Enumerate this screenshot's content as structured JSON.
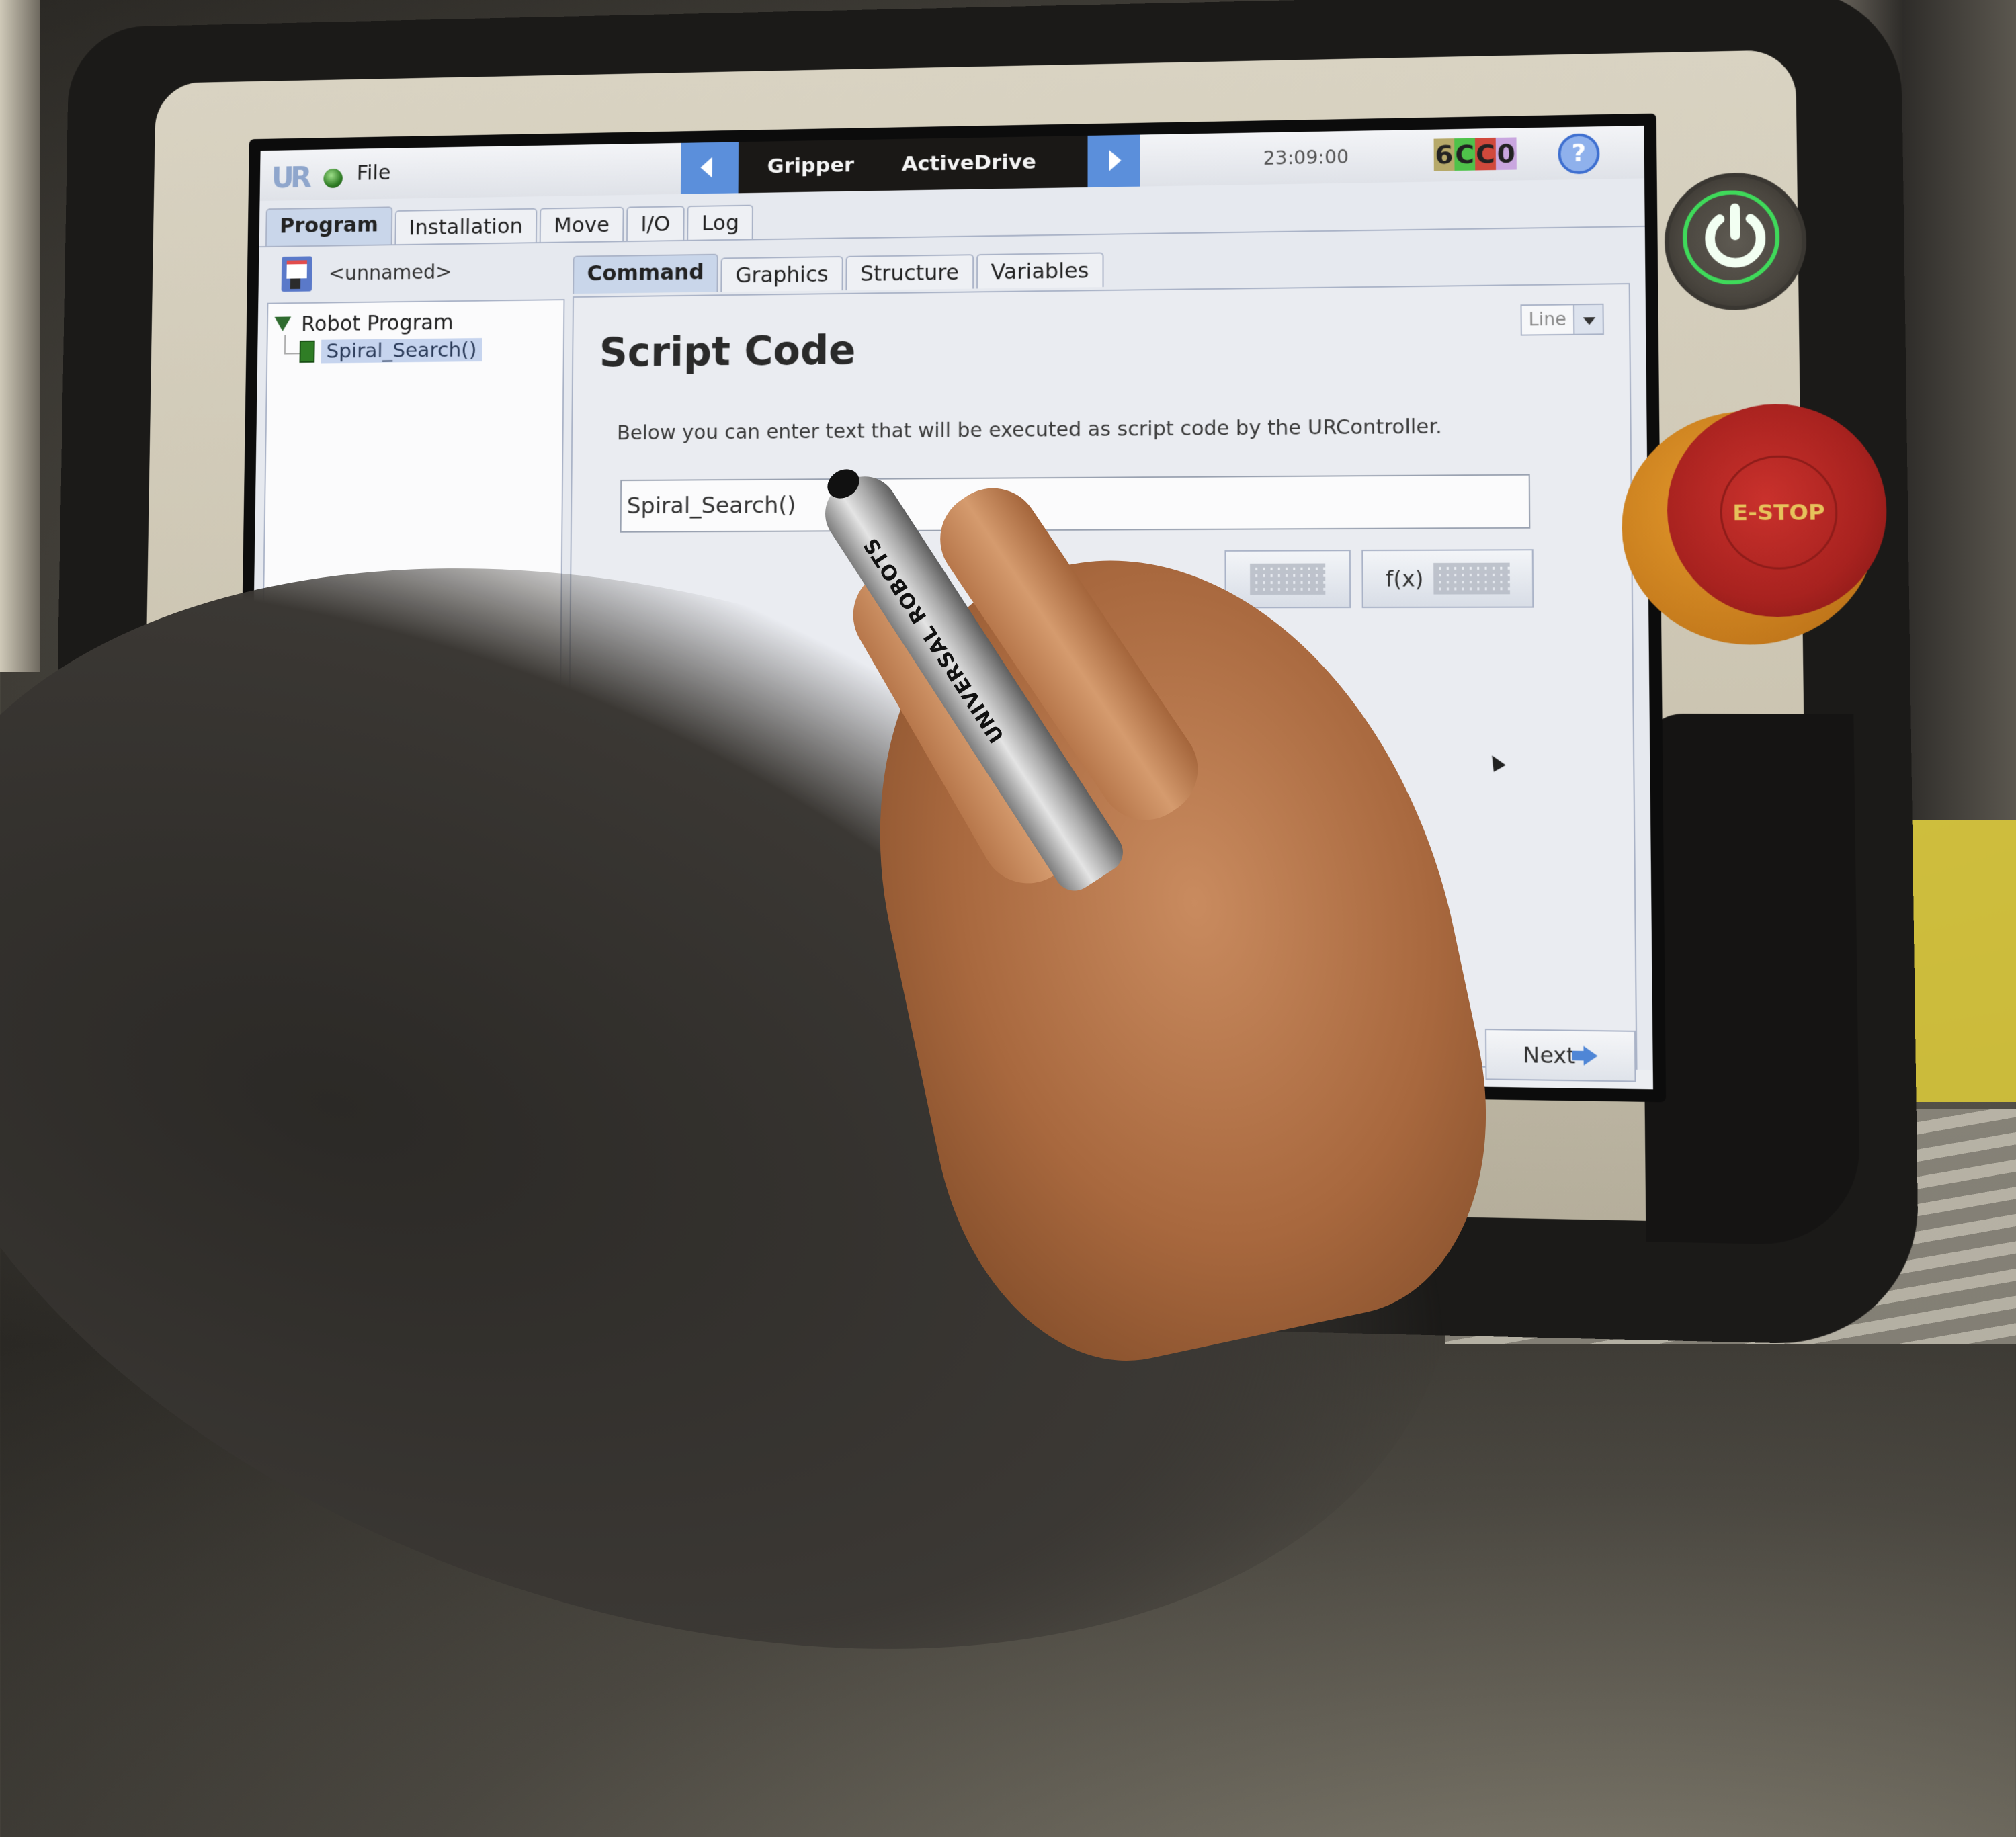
{
  "header": {
    "menu_file": "File",
    "logo": "UR",
    "devices": [
      "Gripper",
      "ActiveDrive"
    ],
    "clock": "23:09:00",
    "status_code": [
      "6",
      "C",
      "C",
      "0"
    ],
    "status_colors": [
      "#b6a96a",
      "#4fc24a",
      "#d0493c",
      "#c9a6df"
    ],
    "help_label": "?"
  },
  "main_tabs": [
    {
      "label": "Program",
      "active": true
    },
    {
      "label": "Installation",
      "active": false
    },
    {
      "label": "Move",
      "active": false
    },
    {
      "label": "I/O",
      "active": false
    },
    {
      "label": "Log",
      "active": false
    }
  ],
  "program": {
    "name": "<unnamed>",
    "tree": {
      "root": "Robot Program",
      "children": [
        "Spiral_Search()"
      ]
    }
  },
  "sub_tabs": [
    {
      "label": "Command",
      "active": true
    },
    {
      "label": "Graphics",
      "active": false
    },
    {
      "label": "Structure",
      "active": false
    },
    {
      "label": "Variables",
      "active": false
    }
  ],
  "content": {
    "heading": "Script Code",
    "mode_dropdown": "Line",
    "description": "Below you can enter text that will be executed as script code by the URController.",
    "script_value": "Spiral_Search()",
    "fx_label": "f(x)"
  },
  "footer": {
    "next_label": "Next"
  },
  "hardware": {
    "estop_label": "E-STOP",
    "pen_text": "UNIVERSAL ROBOTS",
    "power_color": "#3fd95a",
    "accent_blue": "#5b8fdb"
  }
}
